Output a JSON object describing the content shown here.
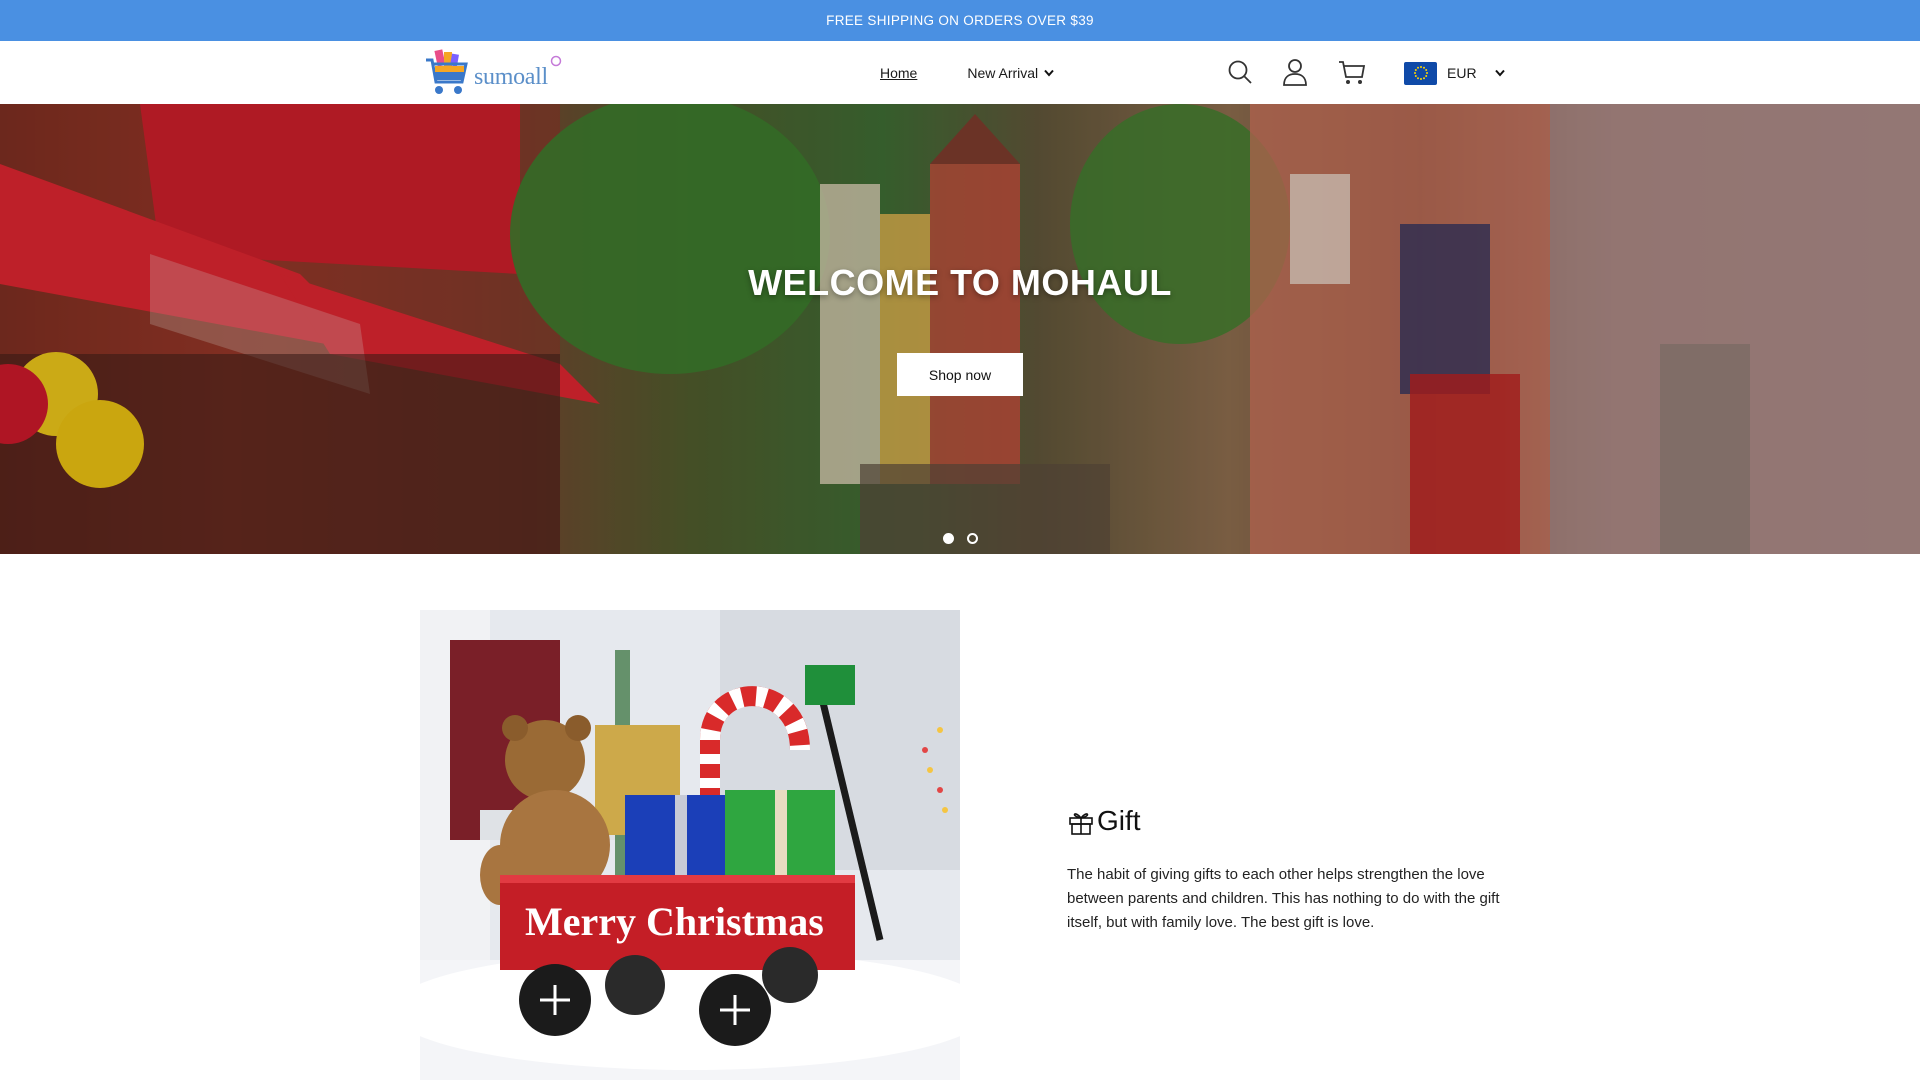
{
  "announcement": {
    "text": "FREE SHIPPING ON ORDERS OVER $39"
  },
  "header": {
    "logo_text": "sumoall",
    "nav": {
      "home": "Home",
      "new_arrival": "New Arrival"
    },
    "currency": "EUR",
    "icons": [
      "search-icon",
      "account-icon",
      "cart-icon",
      "eu-flag-icon",
      "chevron-down-icon"
    ]
  },
  "hero": {
    "title": "WELCOME TO MOHAUL",
    "button": "Shop now",
    "slides": 2,
    "active_slide": 1
  },
  "feature": {
    "title": "Gift",
    "description": "The habit of giving gifts to each other helps strengthen the love between parents and children. This has nothing to do with the gift itself, but with family love. The best gift is love.",
    "image_sign_text": "Merry Christmas"
  },
  "colors": {
    "announcement_bg": "#4a90e2",
    "flag_bg": "#0f4aa8"
  }
}
